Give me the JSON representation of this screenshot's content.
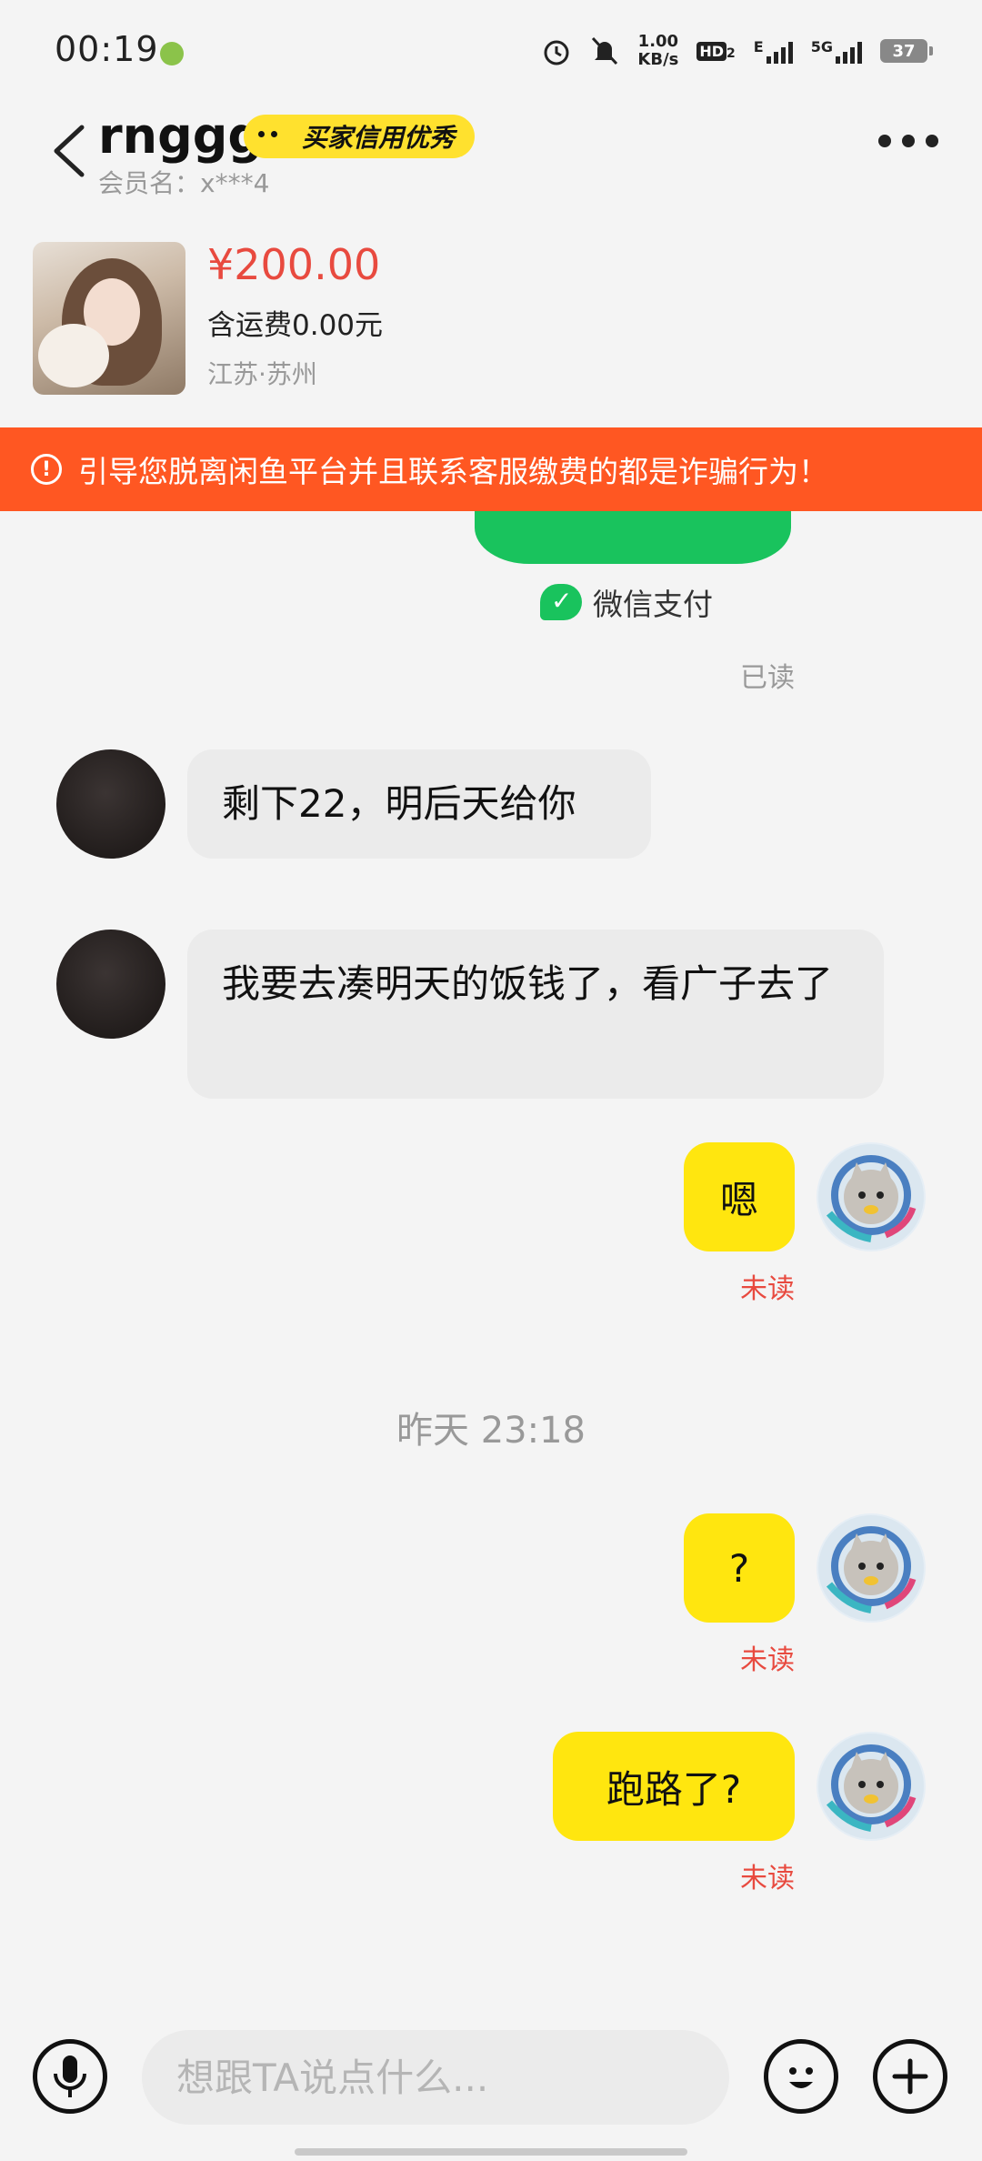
{
  "status_bar": {
    "time": "00:19",
    "net_speed_value": "1.00",
    "net_speed_unit": "KB/s",
    "hd_label": "HD",
    "hd_sub": "2",
    "net_e": "E",
    "net_5g": "5G",
    "battery": "37",
    "icons": [
      "alarm-icon",
      "mute-bell-icon",
      "signal-icon",
      "battery-icon"
    ]
  },
  "header": {
    "title": "rnggg",
    "credit_badge": "买家信用优秀",
    "member_label": "会员名：x***4"
  },
  "product": {
    "price": "¥200.00",
    "shipping": "含运费0.00元",
    "location": "江苏·苏州"
  },
  "warning": {
    "text": "引导您脱离闲鱼平台并且联系客服缴费的都是诈骗行为！"
  },
  "payment_card": {
    "label": "微信支付",
    "status": "已读"
  },
  "messages": [
    {
      "side": "left",
      "text": "剩下22，明后天给你"
    },
    {
      "side": "left",
      "text": "我要去凑明天的饭钱了，看广子去了"
    },
    {
      "side": "right",
      "text": "嗯",
      "status": "未读"
    },
    {
      "side": "right",
      "text": "?",
      "status": "未读"
    },
    {
      "side": "right",
      "text": "跑路了?",
      "status": "未读"
    }
  ],
  "timestamp": "昨天 23:18",
  "input_bar": {
    "placeholder": "想跟TA说点什么..."
  },
  "colors": {
    "accent_yellow": "#ffe60f",
    "warning_orange": "#ff5722",
    "price_red": "#e84a3f",
    "wechat_green": "#19c35d"
  }
}
